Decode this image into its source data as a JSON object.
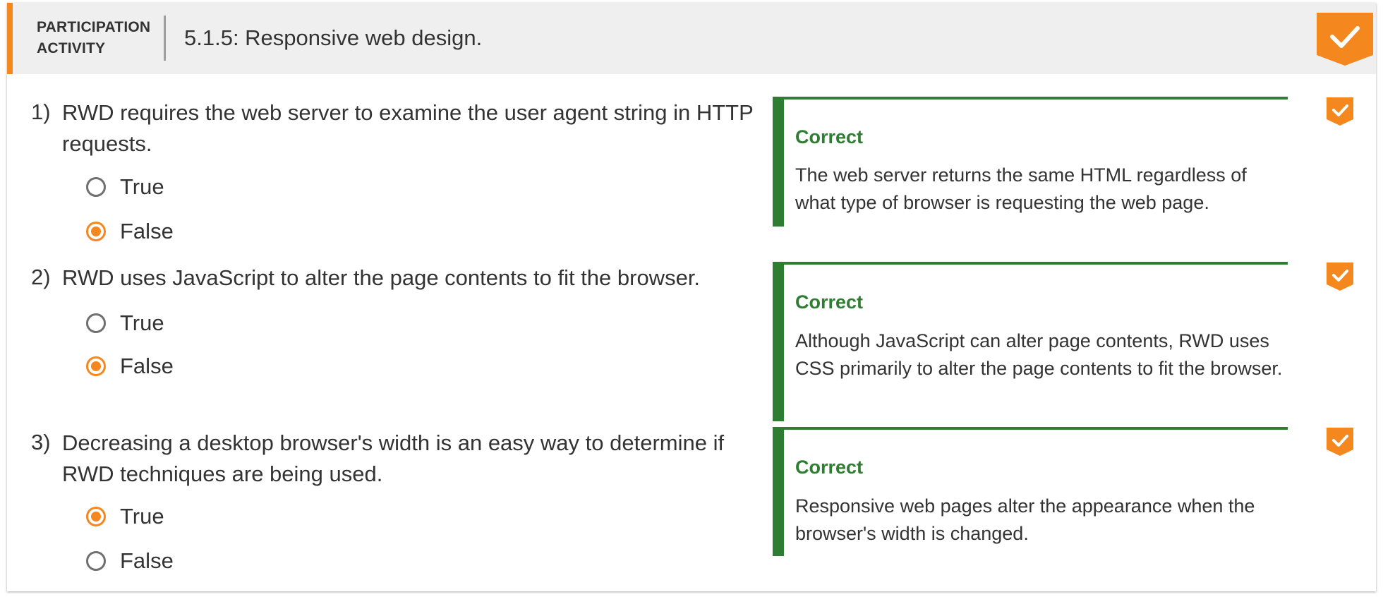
{
  "header": {
    "activity_label": "PARTICIPATION\nACTIVITY",
    "title": "5.1.5: Responsive web design.",
    "complete_icon": "check-badge-icon"
  },
  "colors": {
    "accent": "#f5871f",
    "correct": "#2f7d32",
    "header_bg": "#efefef"
  },
  "questions": [
    {
      "number": "1)",
      "text": "RWD requires the web server to examine the user agent string in HTTP requests.",
      "options": [
        {
          "label": "True",
          "selected": false
        },
        {
          "label": "False",
          "selected": true
        }
      ],
      "feedback": {
        "title": "Correct",
        "text": "The web server returns the same HTML regardless of what type of browser is requesting the web page."
      }
    },
    {
      "number": "2)",
      "text": "RWD uses JavaScript to alter the page contents to fit the browser.",
      "options": [
        {
          "label": "True",
          "selected": false
        },
        {
          "label": "False",
          "selected": true
        }
      ],
      "feedback": {
        "title": "Correct",
        "text": "Although JavaScript can alter page contents, RWD uses CSS primarily to alter the page contents to fit the browser."
      }
    },
    {
      "number": "3)",
      "text": "Decreasing a desktop browser's width is an easy way to determine if RWD techniques are being used.",
      "options": [
        {
          "label": "True",
          "selected": true
        },
        {
          "label": "False",
          "selected": false
        }
      ],
      "feedback": {
        "title": "Correct",
        "text": "Responsive web pages alter the appearance when the browser's width is changed."
      }
    }
  ]
}
